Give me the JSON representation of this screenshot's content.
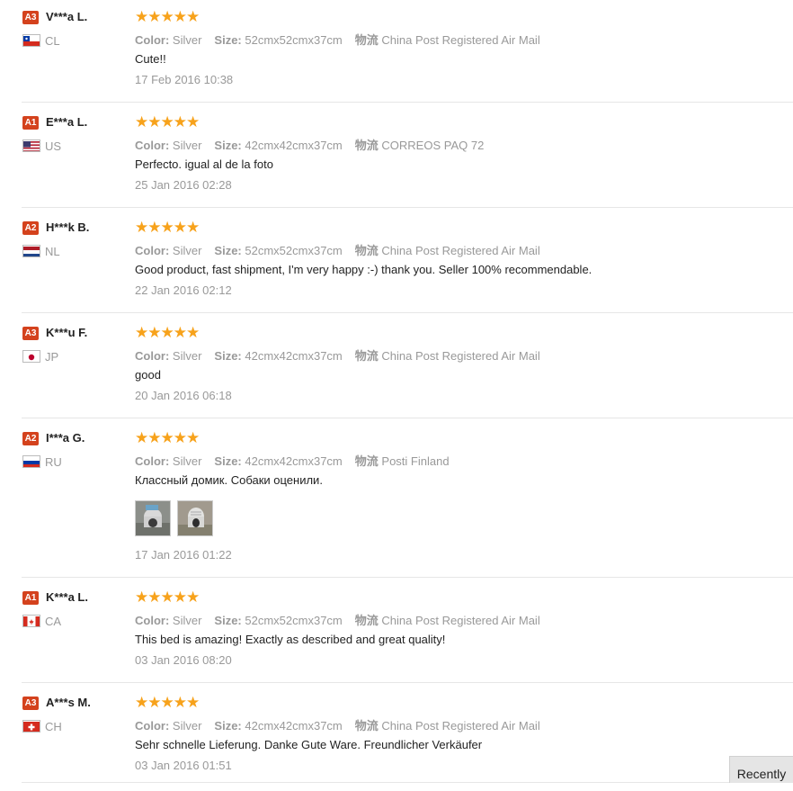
{
  "labels": {
    "color": "Color:",
    "size": "Size:",
    "shipping": "物流"
  },
  "recently_button": "Recently",
  "star_color": "#f7a21b",
  "level_badge_color": "#d4421d",
  "reviews": [
    {
      "level": "A3",
      "name": "V***a L.",
      "country": "CL",
      "flag": "flag-chile-icon",
      "stars": 5,
      "color": "Silver",
      "size": "52cmx52cmx37cm",
      "shipping": "China Post Registered Air Mail",
      "comment": "Cute!!",
      "date": "17 Feb 2016 10:38",
      "photos": 0
    },
    {
      "level": "A1",
      "name": "E***a L.",
      "country": "US",
      "flag": "flag-usa-icon",
      "stars": 5,
      "color": "Silver",
      "size": "42cmx42cmx37cm",
      "shipping": "CORREOS PAQ 72",
      "comment": "Perfecto. igual al de la foto",
      "date": "25 Jan 2016 02:28",
      "photos": 0
    },
    {
      "level": "A2",
      "name": "H***k B.",
      "country": "NL",
      "flag": "flag-netherlands-icon",
      "stars": 5,
      "color": "Silver",
      "size": "52cmx52cmx37cm",
      "shipping": "China Post Registered Air Mail",
      "comment": "Good product, fast shipment, I'm very happy :-) thank you. Seller 100% recommendable.",
      "date": "22 Jan 2016 02:12",
      "photos": 0
    },
    {
      "level": "A3",
      "name": "K***u F.",
      "country": "JP",
      "flag": "flag-japan-icon",
      "stars": 5,
      "color": "Silver",
      "size": "42cmx42cmx37cm",
      "shipping": "China Post Registered Air Mail",
      "comment": "good",
      "date": "20 Jan 2016 06:18",
      "photos": 0
    },
    {
      "level": "A2",
      "name": "I***a G.",
      "country": "RU",
      "flag": "flag-russia-icon",
      "stars": 5,
      "color": "Silver",
      "size": "42cmx42cmx37cm",
      "shipping": "Posti Finland",
      "comment": "Классный домик. Собаки оценили.",
      "date": "17 Jan 2016 01:22",
      "photos": 2
    },
    {
      "level": "A1",
      "name": "K***a L.",
      "country": "CA",
      "flag": "flag-canada-icon",
      "stars": 5,
      "color": "Silver",
      "size": "52cmx52cmx37cm",
      "shipping": "China Post Registered Air Mail",
      "comment": "This bed is amazing! Exactly as described and great quality!",
      "date": "03 Jan 2016 08:20",
      "photos": 0
    },
    {
      "level": "A3",
      "name": "A***s M.",
      "country": "CH",
      "flag": "flag-switzerland-icon",
      "stars": 5,
      "color": "Silver",
      "size": "42cmx42cmx37cm",
      "shipping": "China Post Registered Air Mail",
      "comment": "Sehr schnelle Lieferung. Danke Gute Ware. Freundlicher Verkäufer",
      "date": "03 Jan 2016 01:51",
      "photos": 0
    }
  ]
}
